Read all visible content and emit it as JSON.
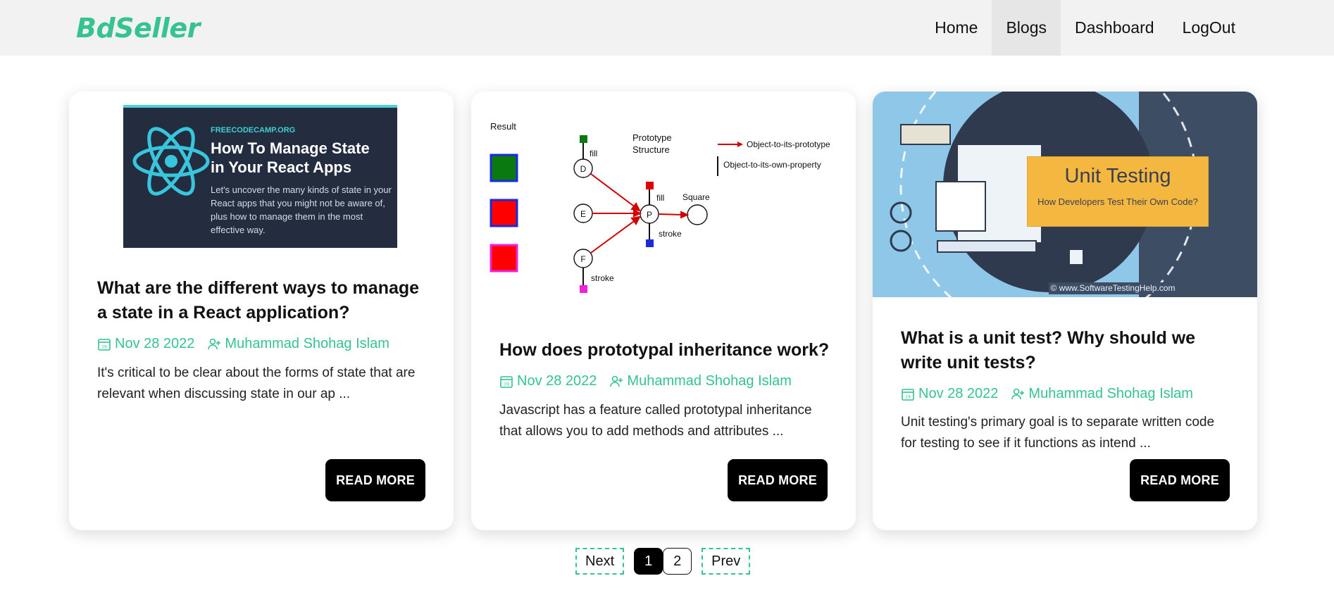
{
  "brand": "BdSeller",
  "nav": [
    {
      "label": "Home"
    },
    {
      "label": "Blogs"
    },
    {
      "label": "Dashboard"
    },
    {
      "label": "LogOut"
    }
  ],
  "cards": [
    {
      "image": {
        "tag": "FREECODECAMP.ORG",
        "headline": "How To Manage State in Your React Apps",
        "subtext": "Let's uncover the many kinds of state in your React apps that you might not be aware of, plus how to manage them in the most effective way."
      },
      "title": "What are the different ways to manage a state in a React application?",
      "date": "Nov 28 2022",
      "author": "Muhammad Shohag Islam",
      "excerpt": "It's critical to be clear about the forms of state that are relevant when discussing state in our ap ...",
      "button": "READ MORE"
    },
    {
      "image": {
        "result_label": "Result",
        "structure_label_1": "Prototype",
        "structure_label_2": "Structure",
        "legend_1": "Object-to-its-prototype",
        "legend_2": "Object-to-its-own-property",
        "node_d": "D",
        "node_e": "E",
        "node_f": "F",
        "node_p": "P",
        "square_label": "Square",
        "fill_label": "fill",
        "stroke_label": "stroke"
      },
      "title": "How does prototypal inheritance work?",
      "date": "Nov 28 2022",
      "author": "Muhammad Shohag Islam",
      "excerpt": "Javascript has a feature called prototypal inheritance that allows you to add methods and attributes ...",
      "button": "READ MORE"
    },
    {
      "image": {
        "title": "Unit Testing",
        "subtitle": "How Developers Test Their Own Code?",
        "credit": "© www.SoftwareTestingHelp.com"
      },
      "title": "What is a unit test? Why should we write unit tests?",
      "date": "Nov 28 2022",
      "author": "Muhammad Shohag Islam",
      "excerpt": "Unit testing's primary goal is to separate written code for testing to see if it functions as intend ...",
      "button": "READ MORE"
    }
  ],
  "pagination": {
    "next": "Next",
    "pages": [
      "1",
      "2"
    ],
    "active_page": "1",
    "prev": "Prev"
  },
  "colors": {
    "accent": "#34c391",
    "button_bg": "#000000",
    "header_bg": "#f2f2f2"
  }
}
